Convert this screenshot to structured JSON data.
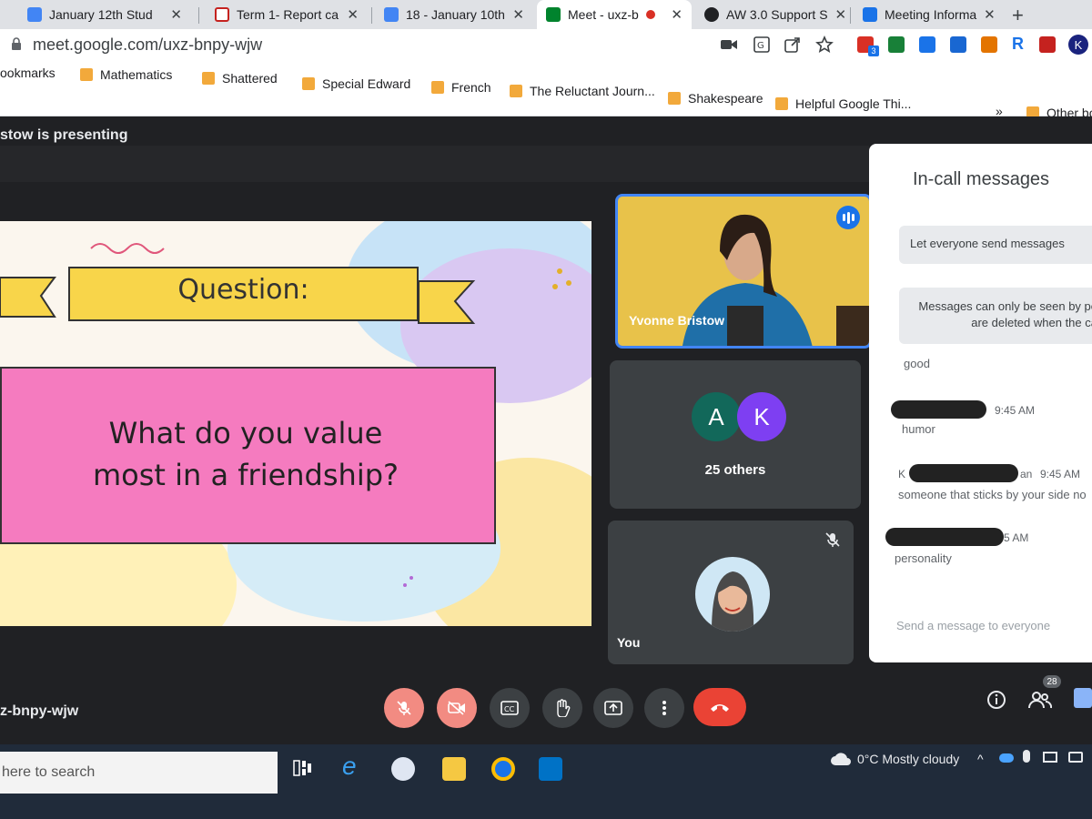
{
  "browser": {
    "tabs": [
      {
        "label": "January 12th Stud",
        "fav": "#4285f4",
        "close": "✕",
        "icon": "docs-icon"
      },
      {
        "label": "Term 1- Report ca",
        "fav": "#c5221f",
        "close": "✕",
        "icon": "slides-icon"
      },
      {
        "label": "18 - January 10th",
        "fav": "#4285f4",
        "close": "✕",
        "icon": "docs-icon"
      },
      {
        "label": "Meet - uxz-b",
        "fav": "#00832d",
        "close": "✕",
        "icon": "meet-icon",
        "active": true
      },
      {
        "label": "AW 3.0 Support S",
        "fav": "#202124",
        "close": "✕",
        "icon": "atom-icon"
      },
      {
        "label": "Meeting Informa",
        "fav": "#1a73e8",
        "close": "✕",
        "icon": "meet-icon"
      }
    ],
    "new_tab": "+",
    "url": "meet.google.com/uxz-bnpy-wjw",
    "bookmarks_label": "ookmarks",
    "bookmarks": [
      "Mathematics",
      "Shattered",
      "Special Edward",
      "French",
      "The Reluctant Journ...",
      "Shakespeare",
      "Helpful Google Thi..."
    ],
    "more": "»",
    "other_bookmarks": "Other bo",
    "ext_badge": "3",
    "ext_letters": [
      "R",
      "K"
    ]
  },
  "meet": {
    "presenting": "stow is presenting",
    "slide": {
      "heading": "Question:",
      "question_line1": "What do you value",
      "question_line2": "most in a friendship?"
    },
    "speaker_name": "Yvonne Bristow",
    "others_avatars": [
      "A",
      "K"
    ],
    "others_label": "25 others",
    "you_label": "You",
    "meeting_code": "z-bnpy-wjw",
    "participant_count": "28"
  },
  "chat": {
    "title": "In-call messages",
    "setting": "Let everyone send messages",
    "note_line1": "Messages can only be seen by pe",
    "note_line2": "are deleted when the ca",
    "messages": [
      {
        "text": "good"
      },
      {
        "time": "9:45 AM",
        "text": "humor"
      },
      {
        "prefix": "K",
        "suffix": "an",
        "time": "9:45 AM",
        "text": "someone that sticks by your side no"
      },
      {
        "time": "5 AM",
        "text": "personality"
      }
    ],
    "input_placeholder": "Send a message to everyone"
  },
  "taskbar": {
    "search": "here to search",
    "weather": "0°C  Mostly cloudy"
  },
  "colors": {
    "meet_bg": "#202124",
    "tile_bg": "#3c4043",
    "speaker_border": "#4285f4",
    "slide_pink": "#f57bbf",
    "ribbon_yellow": "#f8d54a",
    "end_call": "#ea4335"
  }
}
